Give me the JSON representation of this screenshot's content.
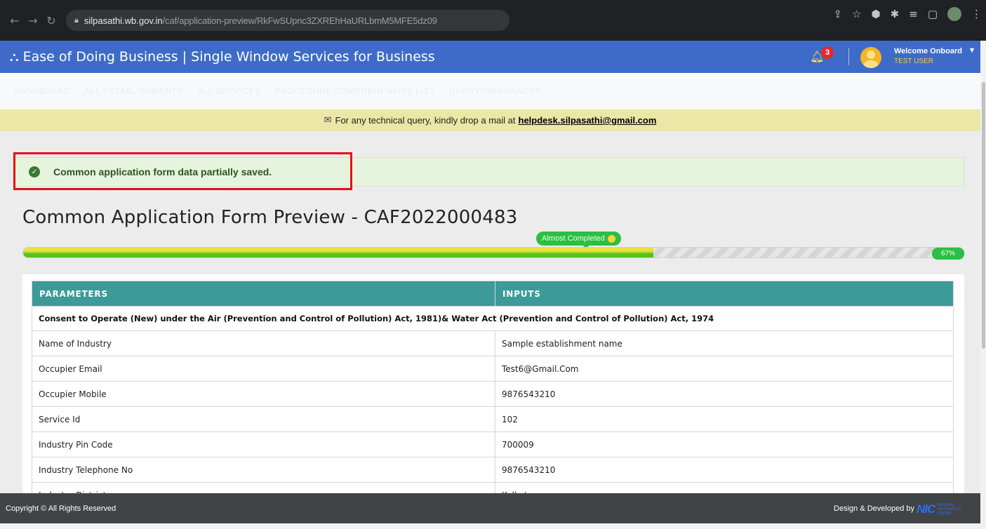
{
  "browser": {
    "url_host": "silpasathi.wb.gov.in",
    "url_path": "/caf/application-preview/RkFwSUpnc3ZXREhHaURLbmM5MFE5dz09"
  },
  "header": {
    "title": "Ease of Doing Business | Single Window Services for Business",
    "notification_count": "3",
    "welcome": "Welcome Onboard",
    "user_name": "TEST USER"
  },
  "nav": {
    "items": [
      "DASHBOARD",
      "ALL ESTABLISHMENTS",
      "ALL SERVICES",
      "PROCEDURE COMPREHENSIVE LIST",
      "QUERY/GRIEVANCES"
    ]
  },
  "notice": {
    "text": "For any technical query, kindly drop a mail at",
    "email": "helpdesk.silpasathi@gmail.com"
  },
  "alert": {
    "message": "Common application form data partially saved."
  },
  "page": {
    "title": "Common Application Form Preview - CAF2022000483"
  },
  "progress": {
    "label": "Almost Completed",
    "percent_text": "67%",
    "percent": 0.67
  },
  "table": {
    "headers": [
      "PARAMETERS",
      "INPUTS"
    ],
    "section_title": "Consent to Operate (New) under the Air (Prevention and Control of Pollution) Act, 1981)& Water Act (Prevention and Control of Pollution) Act, 1974",
    "rows": [
      {
        "param": "Name of Industry",
        "input": "Sample establishment name"
      },
      {
        "param": "Occupier Email",
        "input": "Test6@Gmail.Com"
      },
      {
        "param": "Occupier Mobile",
        "input": "9876543210"
      },
      {
        "param": "Service Id",
        "input": "102"
      },
      {
        "param": "Industry Pin Code",
        "input": "700009"
      },
      {
        "param": "Industry Telephone No",
        "input": "9876543210"
      },
      {
        "param": "Industry District",
        "input": "Kolkata"
      }
    ]
  },
  "footer": {
    "copyright": "Copyright © All Rights Reserved",
    "designed_by": "Design & Developed by",
    "logo_text": "NIC",
    "logo_sub": "NATIONAL INFORMATICS CENTRE"
  },
  "colors": {
    "header_bg": "#3f6bc8",
    "table_header": "#3c9a98",
    "alert_bg": "#e7f4dd",
    "highlight": "#e80b13"
  }
}
